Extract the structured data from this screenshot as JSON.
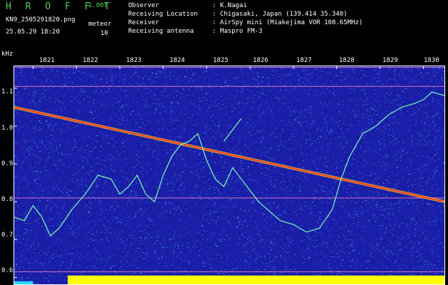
{
  "header": {
    "brand": "H R O F F T",
    "version": "1.00f",
    "filename": "KN9_2505291820.png",
    "datetime": "25.05.29 18:20",
    "meteor_label": "meteor",
    "meteor_count": "10"
  },
  "info": [
    {
      "key": "Observer",
      "value": ": K.Nagai"
    },
    {
      "key": "Receiving Location",
      "value": ": Chigasaki, Japan (139.414 35.340)"
    },
    {
      "key": "Receiver",
      "value": ": AirSpy mini (Miakejima VOR 108.65MHz)"
    },
    {
      "key": "Receiving antenna",
      "value": ": Maspro FM-3"
    }
  ],
  "colors": {
    "background": "#000000",
    "plot_base": "#1a1ea8",
    "noise_light": "#5a8cff",
    "noise_cyan": "#2fd0ff",
    "carrier_red": "#ff3b30",
    "carrier_yellow": "#ffe600",
    "trace_green": "#7dffb0",
    "power_yellow": "#ffff00",
    "power_cyan": "#22d6ff"
  },
  "chart_data": {
    "type": "heatmap",
    "title": "",
    "xlabel": "",
    "ylabel": "kHz",
    "x_ticks": [
      "1821",
      "1822",
      "1823",
      "1824",
      "1825",
      "1826",
      "1827",
      "1828",
      "1829",
      "1830"
    ],
    "x_range": [
      1820.55,
      1830.5
    ],
    "y_ticks": [
      "1.1",
      "1.0",
      "0.9",
      "0.8",
      "0.7",
      "0.6"
    ],
    "y_range": [
      0.58,
      1.16
    ],
    "horizontal_lines_khz": [
      1.155,
      1.105,
      0.81,
      0.615
    ],
    "carrier_line": {
      "x": [
        1820.55,
        1830.5
      ],
      "y": [
        1.05,
        0.8
      ]
    },
    "green_trace": {
      "x": [
        1820.55,
        1820.8,
        1821.0,
        1821.2,
        1821.4,
        1821.6,
        1821.9,
        1822.2,
        1822.5,
        1822.8,
        1823.0,
        1823.2,
        1823.4,
        1823.6,
        1823.8,
        1824.0,
        1824.2,
        1824.4,
        1824.6,
        1824.8,
        1825.0,
        1825.2,
        1825.4,
        1825.6,
        1825.8,
        1826.0,
        1826.2,
        1826.4,
        1826.7,
        1827.0,
        1827.3,
        1827.6,
        1827.9,
        1828.1,
        1828.3,
        1828.6,
        1828.9,
        1829.2,
        1829.5,
        1829.8,
        1830.0,
        1830.2,
        1830.5
      ],
      "y": [
        0.76,
        0.75,
        0.79,
        0.76,
        0.71,
        0.73,
        0.78,
        0.82,
        0.87,
        0.86,
        0.82,
        0.84,
        0.87,
        0.82,
        0.8,
        0.87,
        0.92,
        0.95,
        0.96,
        0.98,
        0.91,
        0.86,
        0.84,
        0.89,
        0.86,
        0.83,
        0.8,
        0.78,
        0.75,
        0.74,
        0.72,
        0.73,
        0.78,
        0.86,
        0.92,
        0.98,
        1.0,
        1.03,
        1.05,
        1.06,
        1.07,
        1.09,
        1.08
      ]
    },
    "green_trace_fragment": {
      "x": [
        1825.4,
        1825.6,
        1825.8
      ],
      "y": [
        0.96,
        0.99,
        1.02
      ]
    },
    "grid": false,
    "legend": "none"
  },
  "power_bar": {
    "cyan_until_x": 1821.0,
    "yellow_from_x": 1821.8,
    "level_khz": 0.605
  }
}
